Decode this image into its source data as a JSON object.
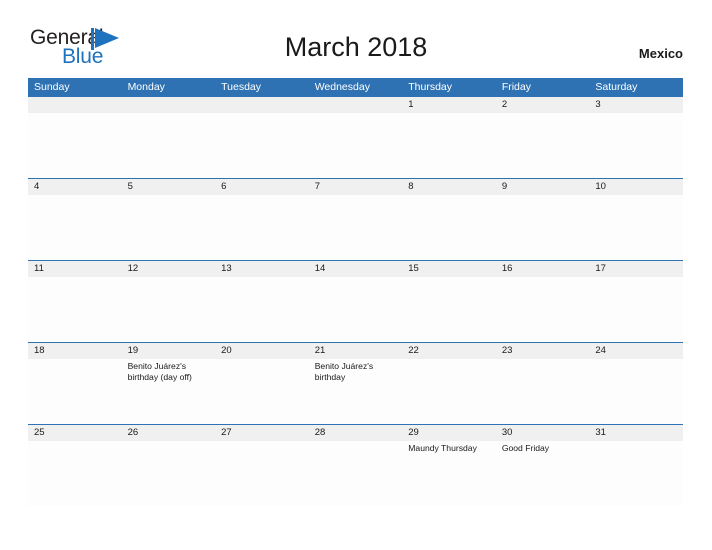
{
  "brand": {
    "name_part1": "General",
    "name_part2": "Blue",
    "flag_icon": "blue-flag-triangle-icon",
    "accent_color": "#1f72bd"
  },
  "header": {
    "title": "March 2018",
    "country": "Mexico"
  },
  "theme": {
    "header_blue": "#2e72b4",
    "row_band_gray": "#f0f0f0",
    "cell_background": "#fdfdfd",
    "text_color": "#1a1a1a"
  },
  "calendar": {
    "month": "March",
    "year": "2018",
    "day_headers": [
      "Sunday",
      "Monday",
      "Tuesday",
      "Wednesday",
      "Thursday",
      "Friday",
      "Saturday"
    ],
    "weeks": [
      {
        "days": [
          {
            "num": "",
            "event": ""
          },
          {
            "num": "",
            "event": ""
          },
          {
            "num": "",
            "event": ""
          },
          {
            "num": "",
            "event": ""
          },
          {
            "num": "1",
            "event": ""
          },
          {
            "num": "2",
            "event": ""
          },
          {
            "num": "3",
            "event": ""
          }
        ]
      },
      {
        "days": [
          {
            "num": "4",
            "event": ""
          },
          {
            "num": "5",
            "event": ""
          },
          {
            "num": "6",
            "event": ""
          },
          {
            "num": "7",
            "event": ""
          },
          {
            "num": "8",
            "event": ""
          },
          {
            "num": "9",
            "event": ""
          },
          {
            "num": "10",
            "event": ""
          }
        ]
      },
      {
        "days": [
          {
            "num": "11",
            "event": ""
          },
          {
            "num": "12",
            "event": ""
          },
          {
            "num": "13",
            "event": ""
          },
          {
            "num": "14",
            "event": ""
          },
          {
            "num": "15",
            "event": ""
          },
          {
            "num": "16",
            "event": ""
          },
          {
            "num": "17",
            "event": ""
          }
        ]
      },
      {
        "days": [
          {
            "num": "18",
            "event": ""
          },
          {
            "num": "19",
            "event": "Benito Juárez's birthday (day off)"
          },
          {
            "num": "20",
            "event": ""
          },
          {
            "num": "21",
            "event": "Benito Juárez's birthday"
          },
          {
            "num": "22",
            "event": ""
          },
          {
            "num": "23",
            "event": ""
          },
          {
            "num": "24",
            "event": ""
          }
        ]
      },
      {
        "days": [
          {
            "num": "25",
            "event": ""
          },
          {
            "num": "26",
            "event": ""
          },
          {
            "num": "27",
            "event": ""
          },
          {
            "num": "28",
            "event": ""
          },
          {
            "num": "29",
            "event": "Maundy Thursday"
          },
          {
            "num": "30",
            "event": "Good Friday"
          },
          {
            "num": "31",
            "event": ""
          }
        ]
      }
    ]
  }
}
